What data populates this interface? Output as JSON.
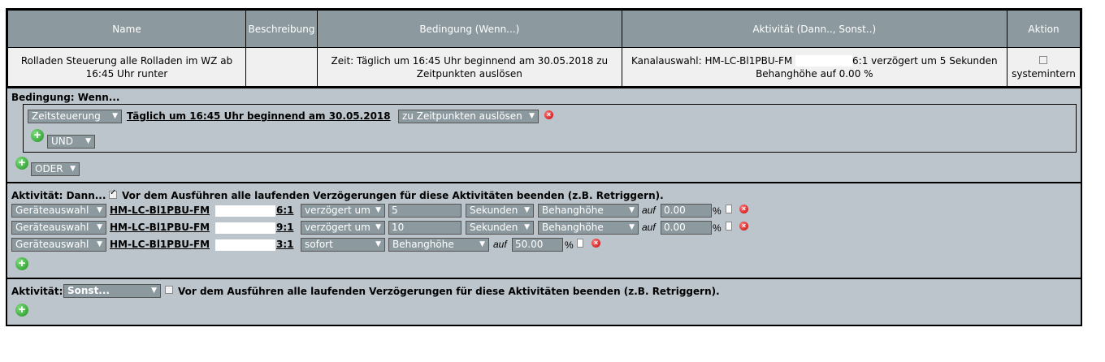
{
  "table": {
    "headers": [
      "Name",
      "Beschreibung",
      "Bedingung (Wenn...)",
      "Aktivität (Dann.., Sonst..)",
      "Aktion"
    ],
    "row": {
      "name": "Rolladen Steuerung alle Rolladen im WZ ab 16:45 Uhr runter",
      "beschreibung": "",
      "bedingung": "Zeit: Täglich um 16:45 Uhr beginnend am 30.05.2018 zu Zeitpunkten auslösen",
      "aktivitaet_pre": "Kanalauswahl: HM-LC-Bl1PBU-FM",
      "aktivitaet_post": "6:1 verzögert um 5 Sekunden Behanghöhe auf 0.00 %",
      "aktion_label": "systemintern"
    }
  },
  "condition": {
    "title": "Bedingung: Wenn...",
    "type_select": "Zeitsteuerung",
    "time_link": "Täglich um 16:45 Uhr beginnend am 30.05.2018",
    "trigger_select": "zu Zeitpunkten auslösen",
    "and_select": "UND",
    "or_select": "ODER"
  },
  "activity_then": {
    "title": "Aktivität: Dann...",
    "retrigger_label": "Vor dem Ausführen alle laufenden Verzögerungen für diese Aktivitäten beenden (z.B. Retriggern).",
    "rows": [
      {
        "select": "Geräteauswahl",
        "device": "HM-LC-Bl1PBU-FM",
        "channel": "6:1",
        "timing": "verzögert um",
        "delay": "5",
        "unit": "Sekunden",
        "param": "Behanghöhe",
        "auf": "auf",
        "value": "0.00",
        "percent": "%"
      },
      {
        "select": "Geräteauswahl",
        "device": "HM-LC-Bl1PBU-FM",
        "channel": "9:1",
        "timing": "verzögert um",
        "delay": "10",
        "unit": "Sekunden",
        "param": "Behanghöhe",
        "auf": "auf",
        "value": "0.00",
        "percent": "%"
      },
      {
        "select": "Geräteauswahl",
        "device": "HM-LC-Bl1PBU-FM",
        "channel": "3:1",
        "timing": "sofort",
        "param": "Behanghöhe",
        "auf": "auf",
        "value": "50.00",
        "percent": "%"
      }
    ]
  },
  "activity_else": {
    "title": "Aktivität:",
    "select": "Sonst...",
    "retrigger_label": "Vor dem Ausführen alle laufenden Verzögerungen für diese Aktivitäten beenden (z.B. Retriggern)."
  },
  "icons": {
    "add": "add-icon",
    "delete": "delete-icon",
    "calendar": "calendar-icon",
    "dropdown": "chevron-down-icon"
  }
}
